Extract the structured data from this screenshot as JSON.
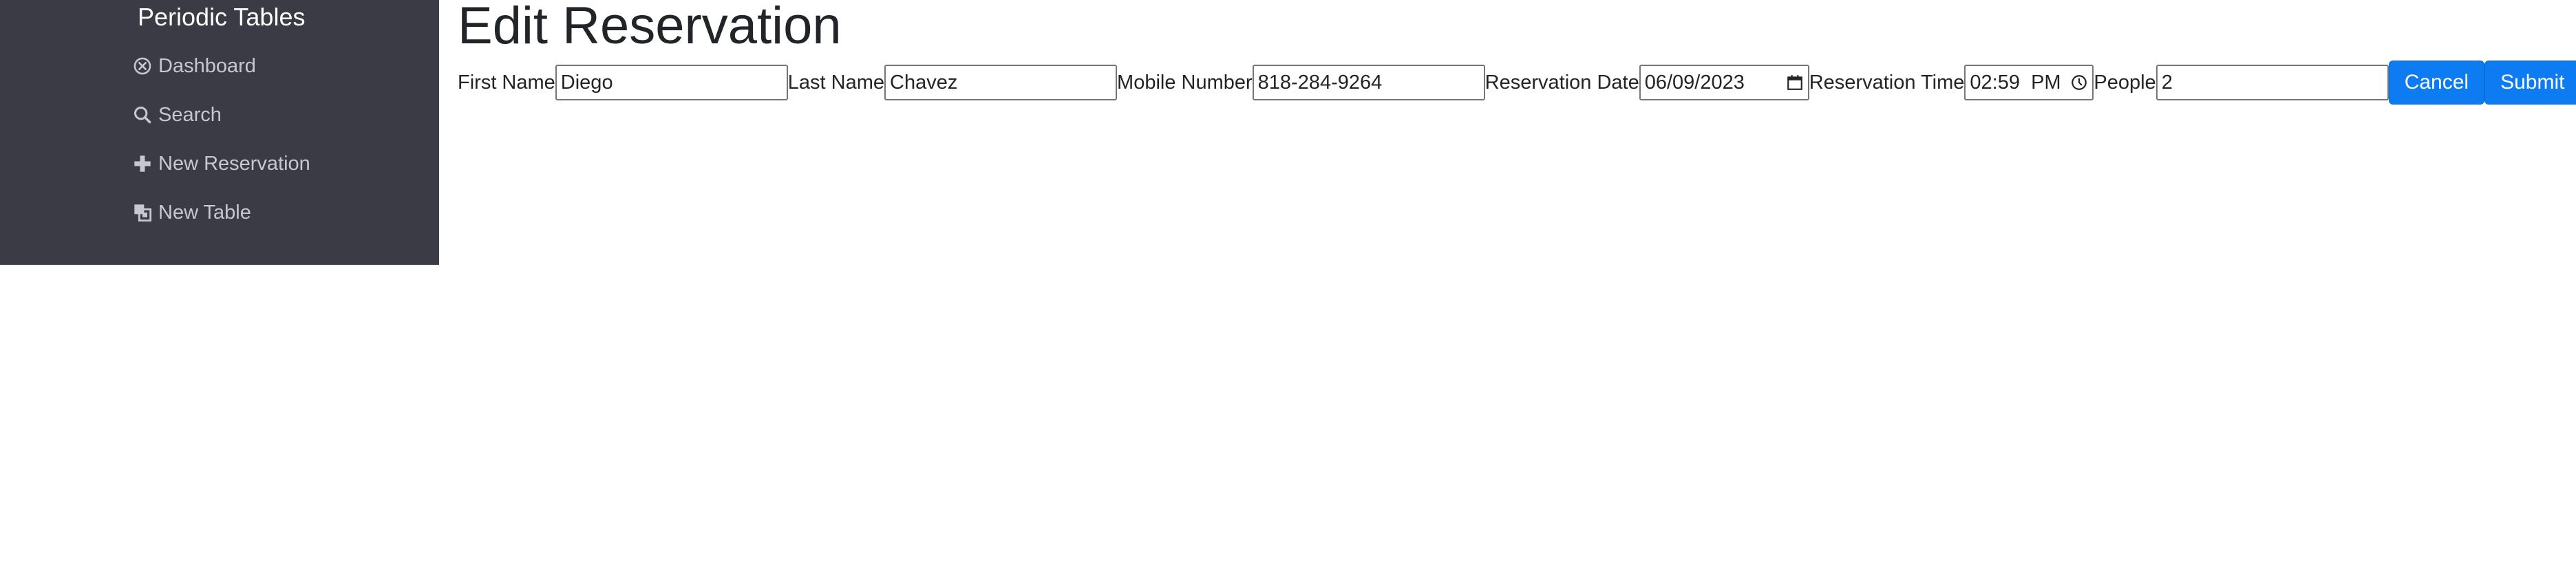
{
  "sidebar": {
    "brand": "Periodic Tables",
    "items": [
      {
        "label": "Dashboard",
        "icon": "dashboard-icon"
      },
      {
        "label": "Search",
        "icon": "search-icon"
      },
      {
        "label": "New Reservation",
        "icon": "plus-icon"
      },
      {
        "label": "New Table",
        "icon": "layers-icon"
      }
    ]
  },
  "main": {
    "title": "Edit Reservation",
    "form": {
      "first_name": {
        "label": "First Name",
        "value": "Diego"
      },
      "last_name": {
        "label": "Last Name",
        "value": "Chavez"
      },
      "mobile_number": {
        "label": "Mobile Number",
        "value": "818-284-9264"
      },
      "reservation_date": {
        "label": "Reservation Date",
        "value": "06/09/2023"
      },
      "reservation_time": {
        "label": "Reservation Time",
        "value": "02:59  PM"
      },
      "people": {
        "label": "People",
        "value": "2"
      }
    },
    "cancel_label": "Cancel",
    "submit_label": "Submit"
  },
  "colors": {
    "sidebar_bg": "#3a3b45",
    "accent": "#0d7cf2"
  }
}
